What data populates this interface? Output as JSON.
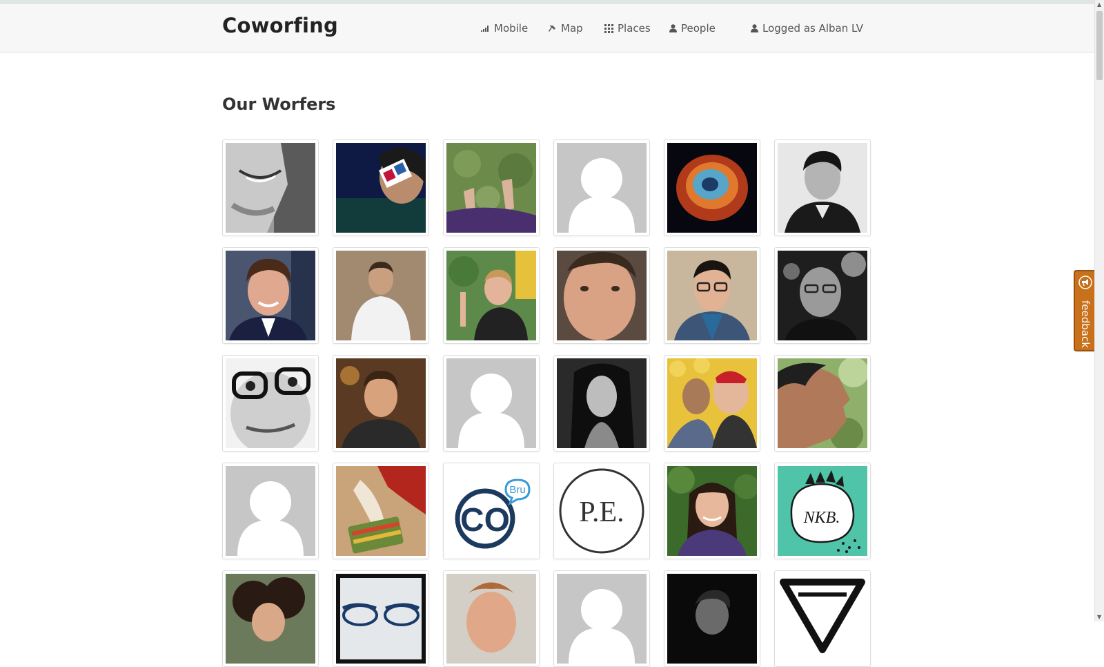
{
  "app": {
    "brand": "Coworfing"
  },
  "nav": {
    "mobile": "Mobile",
    "map": "Map",
    "places": "Places",
    "people": "People",
    "account": "Logged as Alban LV"
  },
  "page": {
    "heading": "Our Worfers"
  },
  "feedback": {
    "label": "feedback"
  },
  "colors": {
    "accent": "#c8701a",
    "navbar_bg": "#f7f7f7",
    "placeholder_bg": "#c6c6c6"
  },
  "profiles": [
    {
      "kind": "photo",
      "desc": "smiling face close-up, black and white"
    },
    {
      "kind": "photo",
      "desc": "person with 3D glasses"
    },
    {
      "kind": "photo",
      "desc": "feet in grass"
    },
    {
      "kind": "placeholder"
    },
    {
      "kind": "photo",
      "desc": "helix nebula"
    },
    {
      "kind": "photo",
      "desc": "man, black and white"
    },
    {
      "kind": "photo",
      "desc": "man in suit"
    },
    {
      "kind": "photo",
      "desc": "man in white sweater"
    },
    {
      "kind": "photo",
      "desc": "waving person"
    },
    {
      "kind": "photo",
      "desc": "face close-up"
    },
    {
      "kind": "photo",
      "desc": "man with glasses and scarf"
    },
    {
      "kind": "photo",
      "desc": "man with glasses, black and white"
    },
    {
      "kind": "photo",
      "desc": "face with glasses, black and white"
    },
    {
      "kind": "photo",
      "desc": "man in dark jacket"
    },
    {
      "kind": "placeholder"
    },
    {
      "kind": "photo",
      "desc": "woman, black and white"
    },
    {
      "kind": "photo",
      "desc": "man with cartoon characters"
    },
    {
      "kind": "photo",
      "desc": "profile in greenery"
    },
    {
      "kind": "placeholder"
    },
    {
      "kind": "photo",
      "desc": "hands with colorful object"
    },
    {
      "kind": "logo",
      "text": "CO",
      "badge": "Bru"
    },
    {
      "kind": "logo",
      "text": "P.E."
    },
    {
      "kind": "photo",
      "desc": "smiling woman"
    },
    {
      "kind": "logo",
      "text": "NKB."
    },
    {
      "kind": "photo",
      "desc": "curly haired person"
    },
    {
      "kind": "photo",
      "desc": "glasses"
    },
    {
      "kind": "photo",
      "desc": "man"
    },
    {
      "kind": "placeholder"
    },
    {
      "kind": "photo",
      "desc": "person on dark background"
    },
    {
      "kind": "logo",
      "desc": "triangle logo"
    }
  ]
}
